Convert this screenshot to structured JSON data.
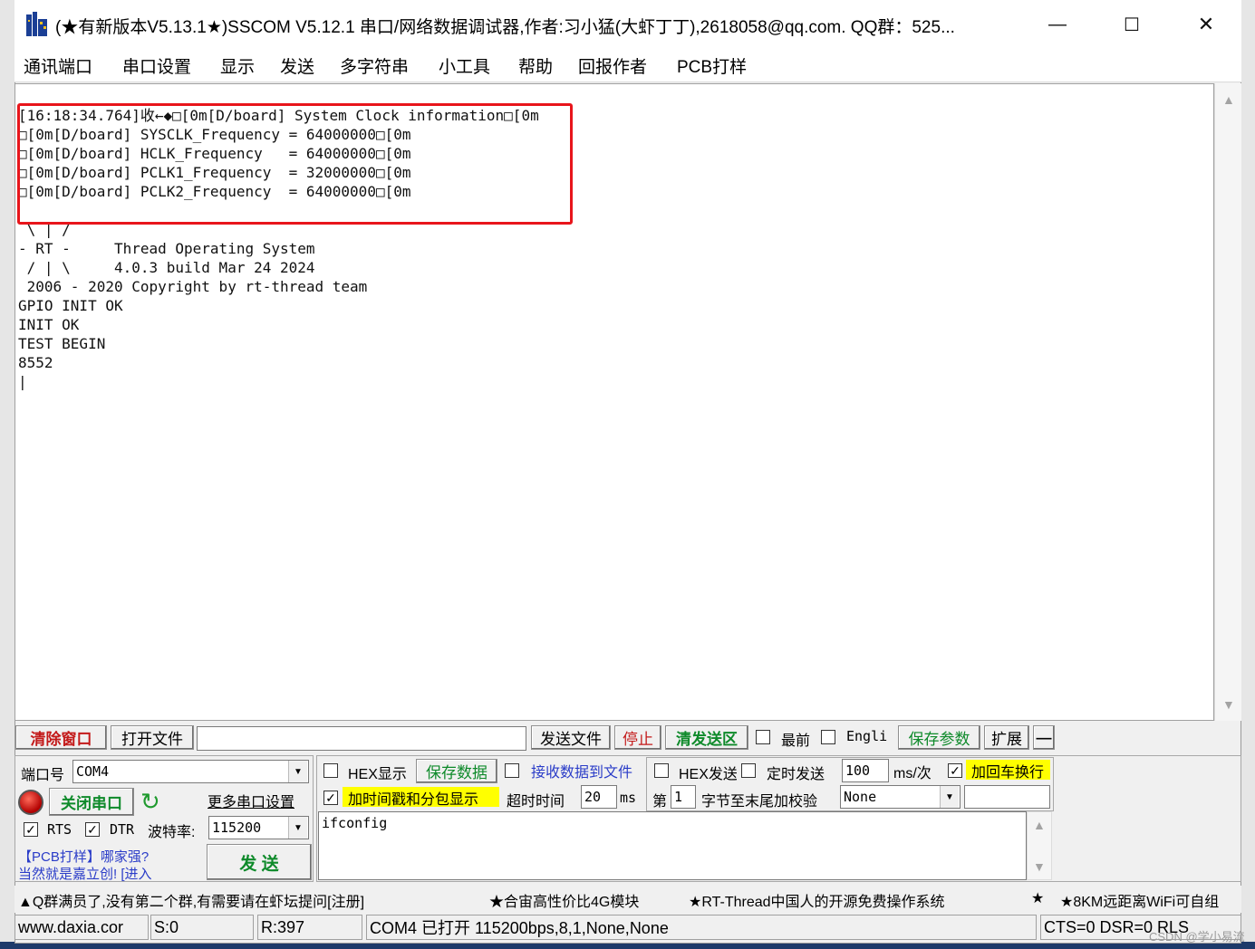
{
  "title": "(★有新版本V5.13.1★)SSCOM V5.12.1 串口/网络数据调试器,作者:习小猛(大虾丁丁),2618058@qq.com. QQ群：525...",
  "window_controls": {
    "minimize": "—",
    "maximize": "☐",
    "close": "✕"
  },
  "menu": [
    "通讯端口",
    "串口设置",
    "显示",
    "发送",
    "多字符串",
    "小工具",
    "帮助",
    "回报作者",
    "PCB打样"
  ],
  "receive_log": "[16:18:34.764]收←◆□[0m[D/board] System Clock information□[0m\n□[0m[D/board] SYSCLK_Frequency = 64000000□[0m\n□[0m[D/board] HCLK_Frequency   = 64000000□[0m\n□[0m[D/board] PCLK1_Frequency  = 32000000□[0m\n□[0m[D/board] PCLK2_Frequency  = 64000000□[0m\n\n \\ | /\n- RT -     Thread Operating System\n / | \\     4.0.3 build Mar 24 2024\n 2006 - 2020 Copyright by rt-thread team\nGPIO INIT OK\nINIT OK\nTEST BEGIN\n8552\n|",
  "toolbar": {
    "clear_window": "清除窗口",
    "open_file": "打开文件",
    "file_path": "",
    "send_file": "发送文件",
    "stop": "停止",
    "clear_send": "清发送区",
    "topmost": "最前",
    "english": "Engli",
    "save_params": "保存参数",
    "expand": "扩展",
    "collapse": "—"
  },
  "port": {
    "port_label": "端口号",
    "port_value": "COM4",
    "close_port": "关闭串口",
    "more_settings": "更多串口设置",
    "rts": "RTS",
    "dtr": "DTR",
    "baud_label": "波特率:",
    "baud_value": "115200"
  },
  "promo": {
    "line1": "【PCB打样】哪家强?",
    "line2": "当然就是嘉立创! [进入"
  },
  "send_button": "发  送",
  "options": {
    "hex_display": "HEX显示",
    "save_data": "保存数据",
    "recv_to_file": "接收数据到文件",
    "timestamp": "加时间戳和分包显示",
    "timeout_label": "超时时间",
    "timeout_value": "20",
    "timeout_unit": "ms",
    "hex_send": "HEX发送",
    "timed_send": "定时发送",
    "interval_value": "100",
    "interval_unit": "ms/次",
    "add_crlf": "加回车换行",
    "index_label": "第",
    "index_value": "1",
    "checksum_label": "字节至末尾加校验",
    "checksum_value": "None"
  },
  "send_text": "ifconfig",
  "ticker": [
    "▲Q群满员了,没有第二个群,有需要请在虾坛提问[注册]",
    "★合宙高性价比4G模块",
    "★RT-Thread中国人的开源免费操作系统",
    "★",
    "★8KM远距离WiFi可自组"
  ],
  "status": {
    "site": "www.daxia.cor",
    "sent": "S:0",
    "received": "R:397",
    "port_state": "COM4 已打开  115200bps,8,1,None,None",
    "lines": "CTS=0 DSR=0 RLS"
  },
  "watermark": "CSDN @学小易流"
}
